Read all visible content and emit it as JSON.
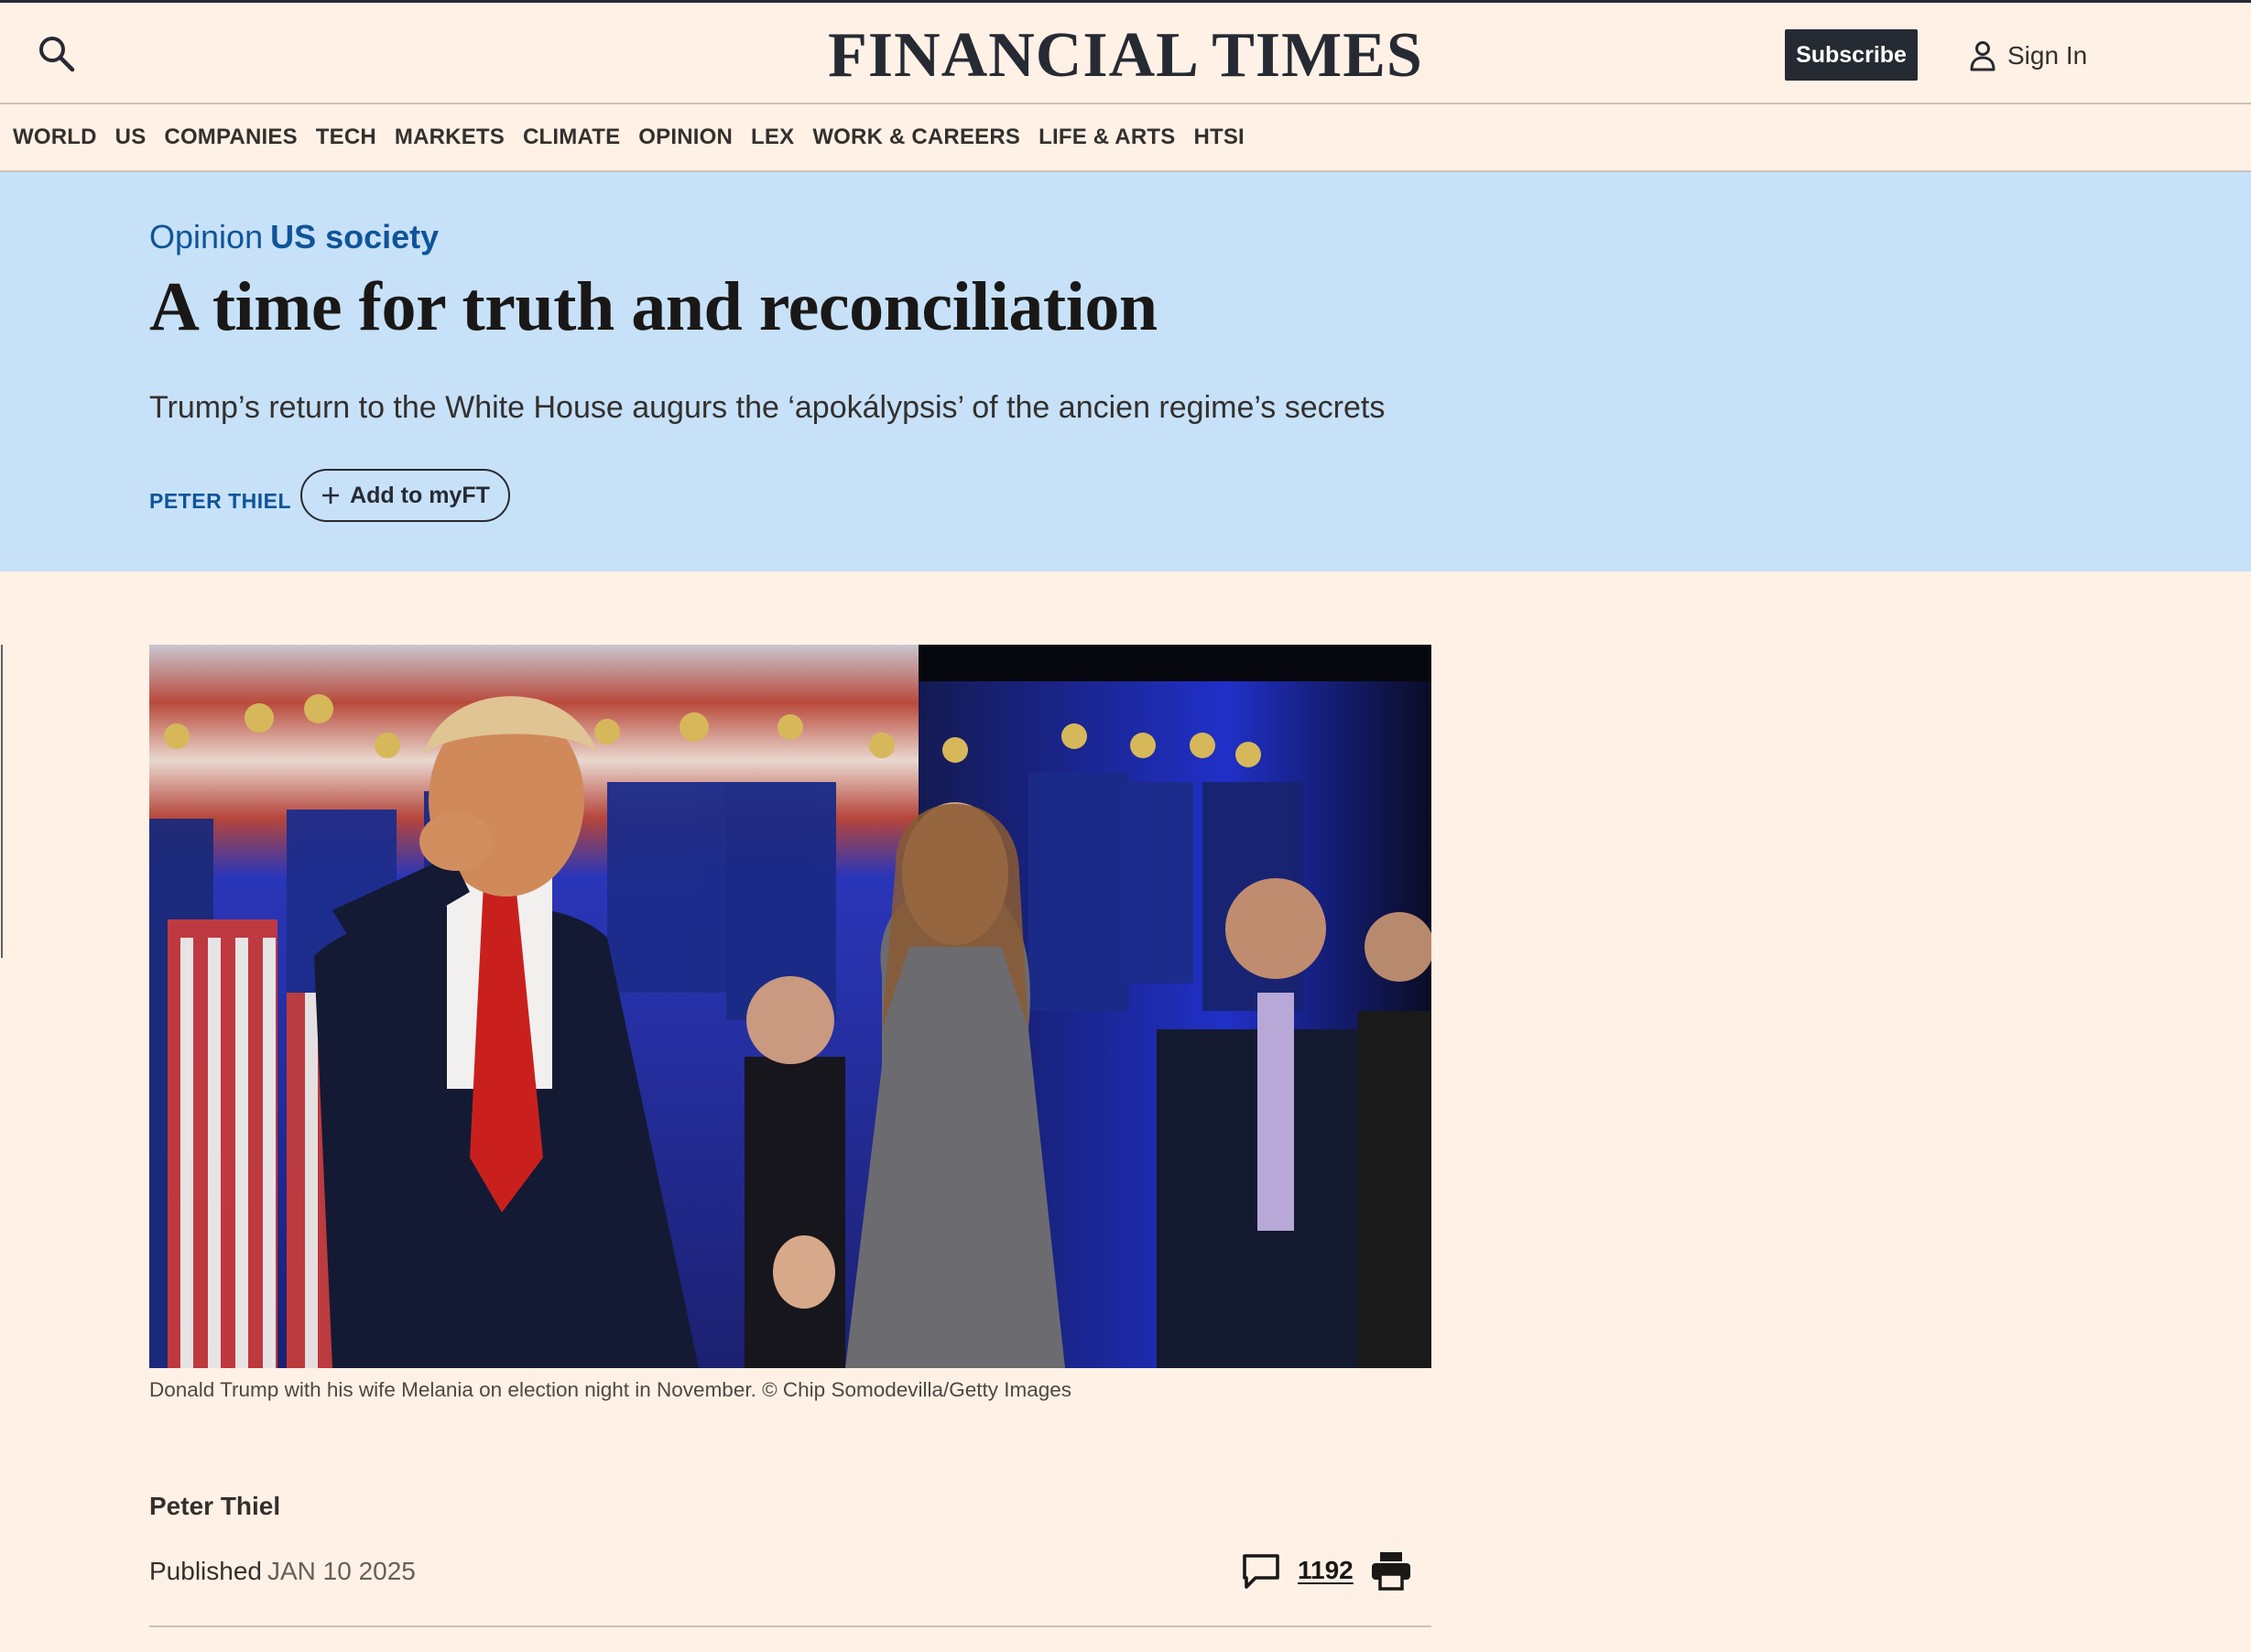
{
  "header": {
    "masthead": "FINANCIAL TIMES",
    "subscribe_label": "Subscribe",
    "signin_label": "Sign In",
    "search_icon": "search-icon",
    "user_icon": "user-icon"
  },
  "nav": {
    "items": [
      "WORLD",
      "US",
      "COMPANIES",
      "TECH",
      "MARKETS",
      "CLIMATE",
      "OPINION",
      "LEX",
      "WORK & CAREERS",
      "LIFE & ARTS",
      "HTSI"
    ]
  },
  "article": {
    "section": "Opinion",
    "topic": "US society",
    "headline": "A time for truth and reconciliation",
    "standfirst": "Trump’s return to the White House augurs the ‘apokálypsis’ of the ancien regime’s secrets",
    "author_tag": "PETER THIEL",
    "myft_label": "Add to myFT",
    "caption": "Donald Trump with his wife Melania on election night in November. © Chip Somodevilla/Getty Images",
    "byline": "Peter Thiel",
    "published_label": "Published",
    "published_date": "JAN 10 2025",
    "comment_count": "1192"
  },
  "colors": {
    "background": "#fff1e5",
    "hero": "#c7e1f8",
    "accent_blue": "#0f5499",
    "dark": "#262a33"
  }
}
